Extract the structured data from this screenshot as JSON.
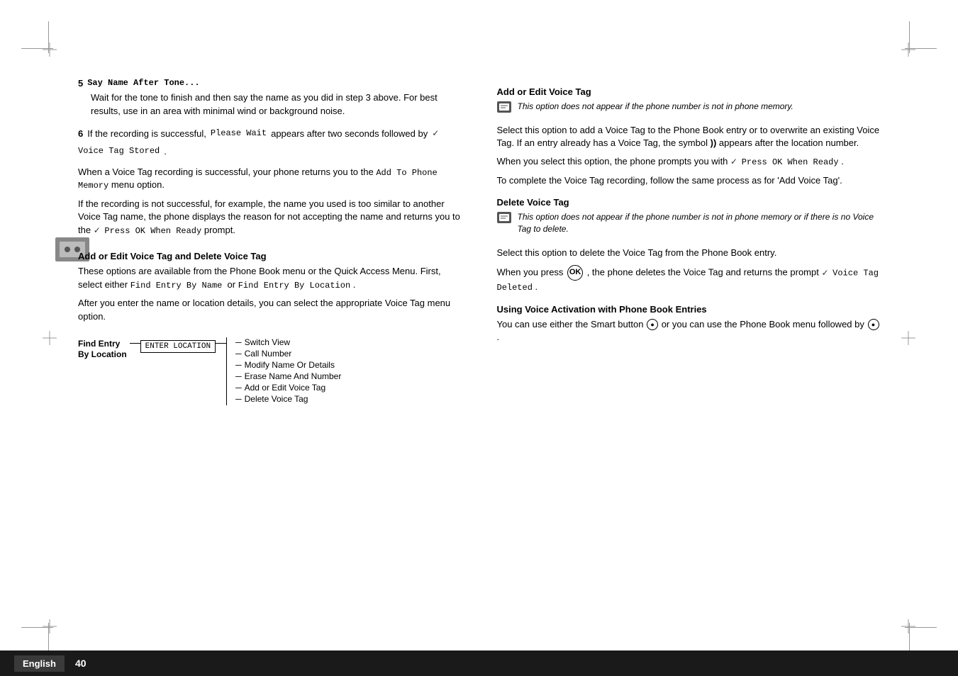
{
  "page": {
    "number": "40",
    "language": "English"
  },
  "crosshairs": {
    "positions": [
      "top-left",
      "top-right",
      "bottom-left",
      "bottom-right",
      "mid-left",
      "mid-right"
    ]
  },
  "left_column": {
    "step5": {
      "number": "5",
      "label": "Say Name After Tone...",
      "body": "Wait for the tone to finish and then say the name as you did in step 3 above. For best results, use in an area with minimal wind or background noise."
    },
    "step6": {
      "number": "6",
      "prefix": "If the recording is successful,",
      "mono1": "Please Wait",
      "mid": "appears after two seconds followed by",
      "mono2": "Voice Tag Stored",
      "suffix": "."
    },
    "para1": "When a Voice Tag recording is successful, your phone returns you to the",
    "para1_mono": "Add To Phone Memory",
    "para1_end": "menu option.",
    "para2_start": "If the recording is not successful, for example, the name you used is too similar to another Voice Tag name, the phone displays the reason for not accepting the name and returns you to the",
    "para2_mono": "Press OK When Ready",
    "para2_end": "prompt.",
    "section_heading": "Add or Edit Voice Tag and Delete Voice Tag",
    "section_body1": "These options are available from the Phone Book menu or the Quick Access Menu. First, select either",
    "section_body1_mono1": "Find Entry By Name",
    "section_body1_or": "or",
    "section_body1_mono2": "Find Entry By Location",
    "section_body1_end": ".",
    "section_body2": "After you enter the name or location details, you can select the appropriate Voice Tag menu option.",
    "diagram": {
      "find_entry_label_line1": "Find Entry",
      "find_entry_label_line2": "By Location",
      "enter_location_box": "ENTER LOCATION",
      "menu_items": [
        "Switch View",
        "Call Number",
        "Modify Name Or Details",
        "Erase Name And Number",
        "Add or Edit Voice Tag",
        "Delete Voice Tag"
      ]
    }
  },
  "right_column": {
    "section1": {
      "heading": "Add or Edit Voice Tag",
      "note_italic": "This option does not appear if the phone number is not in phone memory.",
      "body1": "Select this option to add a Voice Tag to the Phone Book entry or to overwrite an existing Voice Tag. If an entry already has a Voice Tag, the symbol",
      "body1_symbol": "))",
      "body1_end": "appears after the location number.",
      "body2_start": "When you select this option, the phone prompts you with",
      "body2_mono": "Press OK When Ready",
      "body2_end": ".",
      "body3": "To complete the Voice Tag recording, follow the same process as for 'Add Voice Tag'."
    },
    "section2": {
      "heading": "Delete Voice Tag",
      "note_italic": "This option does not appear if the phone number is not in phone memory or if there is no Voice Tag to delete.",
      "body1": "Select this option to delete the Voice Tag from the Phone Book entry.",
      "body2_start": "When you press",
      "body2_ok": "OK",
      "body2_end": ", the phone deletes the Voice Tag and returns the prompt",
      "body2_mono": "Voice Tag Deleted",
      "body2_end2": "."
    },
    "section3": {
      "heading": "Using Voice Activation with Phone Book Entries",
      "body1_start": "You can use either the Smart button",
      "body1_smart": "●",
      "body1_mid": "or you can use the Phone Book menu followed by",
      "body1_end_symbol": "●",
      "body1_end": "."
    }
  }
}
